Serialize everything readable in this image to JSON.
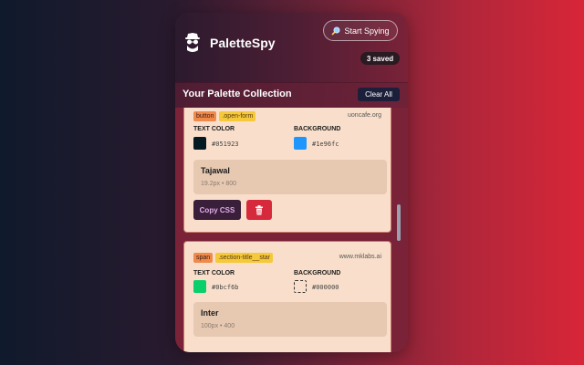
{
  "app": {
    "title": "PaletteSpy",
    "start_label": "Start Spying",
    "saved_badge": "3 saved"
  },
  "collection": {
    "title": "Your Palette Collection",
    "clear_label": "Clear All"
  },
  "labels": {
    "text_color": "TEXT COLOR",
    "background": "BACKGROUND",
    "copy_css": "Copy CSS"
  },
  "cards": [
    {
      "element": "button",
      "selector": ".open-form",
      "site": "uoncafe.org",
      "text_color": "#051923",
      "background": "#1e96fc",
      "font_name": "Tajawal",
      "font_meta": "19.2px • 800"
    },
    {
      "element": "span",
      "selector": ".section-title__star",
      "site": "www.mklabs.ai",
      "text_color": "#0bcf6b",
      "background": "#000000",
      "font_name": "Inter",
      "font_meta": "100px • 400"
    }
  ],
  "icons": {
    "logo": "spy-icon",
    "start": "magnifier-icon",
    "delete": "trash-icon"
  },
  "colors": {
    "accent": "#d62a3c",
    "card_bg": "#f9dfcb"
  }
}
